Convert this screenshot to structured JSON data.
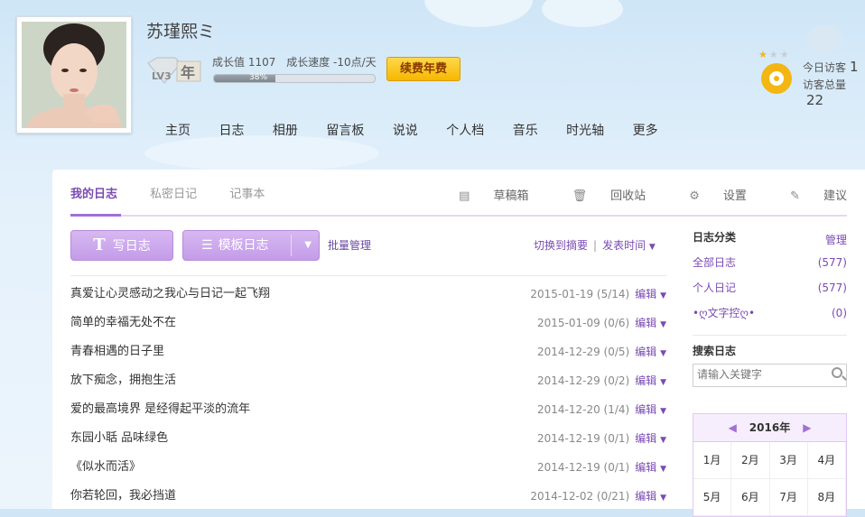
{
  "profile": {
    "nickname": "苏瑾熙ミ",
    "level_text": "LV3",
    "year_badge": "年",
    "growth_value": "成长值 1107",
    "growth_speed": "成长速度 -10点/天",
    "progress_percent": 38,
    "progress_label": "38%",
    "renew_button": "续费年费"
  },
  "nav": [
    "主页",
    "日志",
    "相册",
    "留言板",
    "说说",
    "个人档",
    "音乐",
    "时光轴",
    "更多"
  ],
  "visitors": {
    "today_label": "今日访客",
    "today_value": "1",
    "total_label": "访客总量",
    "total_value": "22"
  },
  "tabs": {
    "my_diary": "我的日志",
    "private_diary": "私密日记",
    "notebook": "记事本"
  },
  "tools": {
    "drafts": "草稿箱",
    "recycle": "回收站",
    "settings": "设置",
    "suggest": "建议"
  },
  "actions": {
    "write": "写日志",
    "template": "模板日志",
    "bulk": "批量管理",
    "switch_summary": "切换到摘要",
    "sort_time": "发表时间"
  },
  "diary_list": [
    {
      "title": "真爱让心灵感动之我心与日记一起飞翔",
      "date": "2015-01-19",
      "stats": "(5/14)",
      "edit": "编辑"
    },
    {
      "title": "简单的幸福无处不在",
      "date": "2015-01-09",
      "stats": "(0/6)",
      "edit": "编辑"
    },
    {
      "title": "青春相遇的日子里",
      "date": "2014-12-29",
      "stats": "(0/5)",
      "edit": "编辑"
    },
    {
      "title": "放下痴念，拥抱生活",
      "date": "2014-12-29",
      "stats": "(0/2)",
      "edit": "编辑"
    },
    {
      "title": "爱的最高境界 是经得起平淡的流年",
      "date": "2014-12-20",
      "stats": "(1/4)",
      "edit": "编辑"
    },
    {
      "title": "东园小聒 品味绿色",
      "date": "2014-12-19",
      "stats": "(0/1)",
      "edit": "编辑"
    },
    {
      "title": "《似水而活》",
      "date": "2014-12-19",
      "stats": "(0/1)",
      "edit": "编辑"
    },
    {
      "title": "你若轮回，我必挡道",
      "date": "2014-12-02",
      "stats": "(0/21)",
      "edit": "编辑"
    }
  ],
  "sidebar": {
    "category_title": "日志分类",
    "manage": "管理",
    "categories": [
      {
        "name": "全部日志",
        "count": "(577)"
      },
      {
        "name": "个人日记",
        "count": "(577)"
      },
      {
        "name": "•ღ文字控ღ•",
        "count": "(0)"
      }
    ],
    "search_title": "搜索日志",
    "search_placeholder": "请输入关键字"
  },
  "calendar": {
    "year": "2016年",
    "months": [
      "1月",
      "2月",
      "3月",
      "4月",
      "5月",
      "6月",
      "7月",
      "8月"
    ]
  },
  "colors": {
    "accent": "#a16fd6",
    "link": "#7a4bb3",
    "renew": "#f5b800"
  }
}
